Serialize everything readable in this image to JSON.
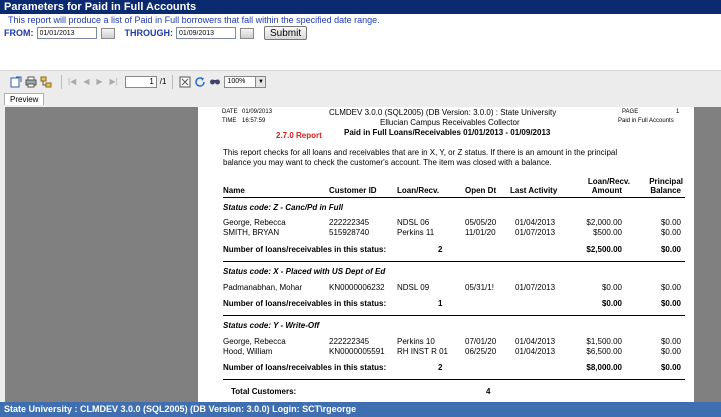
{
  "window": {
    "title": "Parameters for Paid in Full Accounts"
  },
  "form": {
    "description": "This report will produce a list of Paid in Full borrowers that fall within the specified date range.",
    "from_label": "FROM:",
    "from_value": "01/01/2013",
    "through_label": "THROUGH:",
    "through_value": "01/09/2013",
    "submit_label": "Submit"
  },
  "viewer": {
    "page_current": "1",
    "page_total": "/1",
    "zoom": "100%",
    "tab_preview": "Preview"
  },
  "report": {
    "date_label": "DATE",
    "date_value": "01/09/2013",
    "time_label": "TIME",
    "time_value": "16:57:59",
    "system_line": "CLMDEV 3.0.0 (SQL2005) (DB Version:  3.0.0)  :  State University",
    "app_line": "Ellucian Campus Receivables Collector",
    "title_line": "Paid in Full Loans/Receivables 01/01/2013 - 01/09/2013",
    "page_label": "PAGE",
    "page_value": "1",
    "report_name": "Paid in Full Accounts",
    "version_badge": "2.7.0 Report",
    "intro_1": "This report checks for all loans and receivables that are in  X, Y, or Z status.  If there is an amount in the principal",
    "intro_2": "balance you may want to check the customer's account.  The item was closed with a balance.",
    "columns": {
      "name": "Name",
      "customer_id": "Customer ID",
      "loan": "Loan/Recv.",
      "open_dt": "Open Dt",
      "last_activity": "Last Activity",
      "amount_1": "Loan/Recv.",
      "amount_2": "Amount",
      "principal_1": "Principal",
      "principal_2": "Balance"
    },
    "count_label": "Number of loans/receivables in this status:",
    "groups": [
      {
        "title": "Status code: Z - Canc/Pd in Full",
        "rows": [
          {
            "name": "George, Rebecca",
            "id": "222222345",
            "loan": "NDSL 06",
            "open": "05/05/20",
            "last": "01/04/2013",
            "amount": "$2,000.00",
            "balance": "$0.00"
          },
          {
            "name": "SMITH, BRYAN",
            "id": "515928740",
            "loan": "Perkins 11",
            "open": "11/01/20",
            "last": "01/07/2013",
            "amount": "$500.00",
            "balance": "$0.00"
          }
        ],
        "count": "2",
        "total_amount": "$2,500.00",
        "total_balance": "$0.00"
      },
      {
        "title": "Status code: X - Placed with US Dept of Ed",
        "rows": [
          {
            "name": "Padmanabhan, Mohar",
            "id": "KN0000006232",
            "loan": "NDSL 09",
            "open": "05/31/1!",
            "last": "01/07/2013",
            "amount": "$0.00",
            "balance": "$0.00"
          }
        ],
        "count": "1",
        "total_amount": "$0.00",
        "total_balance": "$0.00"
      },
      {
        "title": "Status code: Y - Write-Off",
        "rows": [
          {
            "name": "George, Rebecca",
            "id": "222222345",
            "loan": "Perkins 10",
            "open": "07/01/20",
            "last": "01/04/2013",
            "amount": "$1,500.00",
            "balance": "$0.00"
          },
          {
            "name": "Hood, William",
            "id": "KN0000005591",
            "loan": "RH INST R 01",
            "open": "06/25/20",
            "last": "01/04/2013",
            "amount": "$6,500.00",
            "balance": "$0.00"
          }
        ],
        "count": "2",
        "total_amount": "$8,000.00",
        "total_balance": "$0.00"
      }
    ],
    "total_customers_label": "Total Customers:",
    "total_customers_value": "4"
  },
  "statusbar": {
    "text": "State University : CLMDEV 3.0.0 (SQL2005) (DB Version: 3.0.0) Login: SCT\\rgeorge"
  },
  "colors": {
    "titlebar": "#0b2a6f",
    "label_blue": "#1f3aa8",
    "badge_red": "#d42020",
    "statusbar": "#3f6fb0",
    "pane_gray": "#808080"
  }
}
